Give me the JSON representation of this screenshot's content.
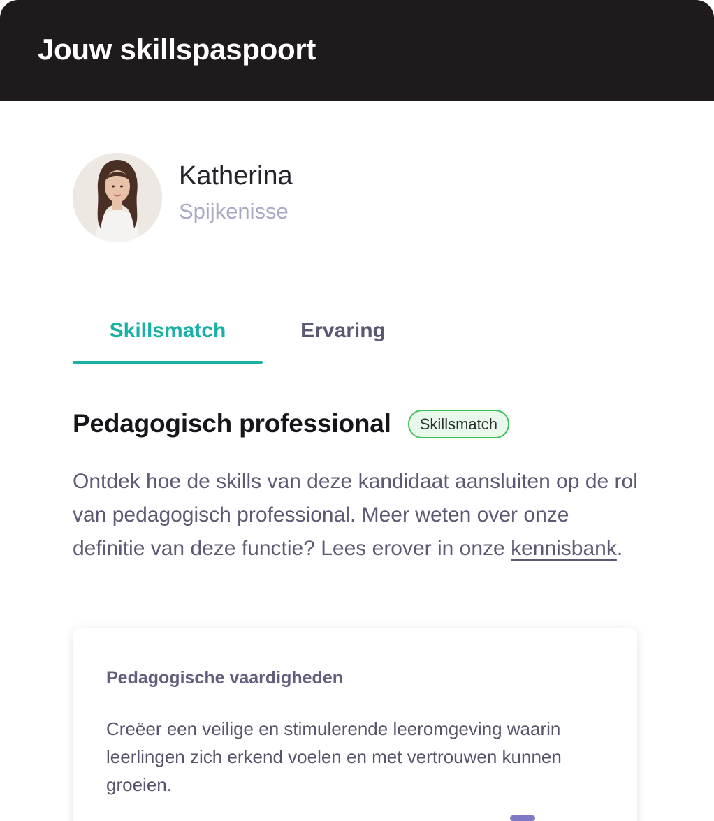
{
  "header": {
    "title": "Jouw skillspaspoort"
  },
  "profile": {
    "name": "Katherina",
    "location": "Spijkenisse",
    "avatar_icon": "profile-photo"
  },
  "tabs": [
    {
      "label": "Skillsmatch",
      "active": true
    },
    {
      "label": "Ervaring",
      "active": false
    }
  ],
  "section": {
    "title": "Pedagogisch professional",
    "badge": "Skillsmatch",
    "intro_text": "Ontdek hoe de skills van deze kandidaat aansluiten op de rol van pedagogisch professional. Meer weten over onze definitie van deze functie? Lees erover in onze ",
    "link_label": "kennisbank",
    "intro_end": "."
  },
  "card": {
    "title": "Pedagogische vaardigheden",
    "text": "Creëer een veilige en stimulerende leeromgeving waarin leerlingen zich erkend voelen en met vertrouwen kunnen groeien."
  },
  "colors": {
    "header_bg": "#1f1b1c",
    "accent": "#1ab0a4",
    "badge_border": "#3ec159",
    "badge_bg": "#e8f8ea",
    "muted_text": "#a7a9c2",
    "body_text": "#5b5a72",
    "card_handle": "#7f78c4"
  }
}
